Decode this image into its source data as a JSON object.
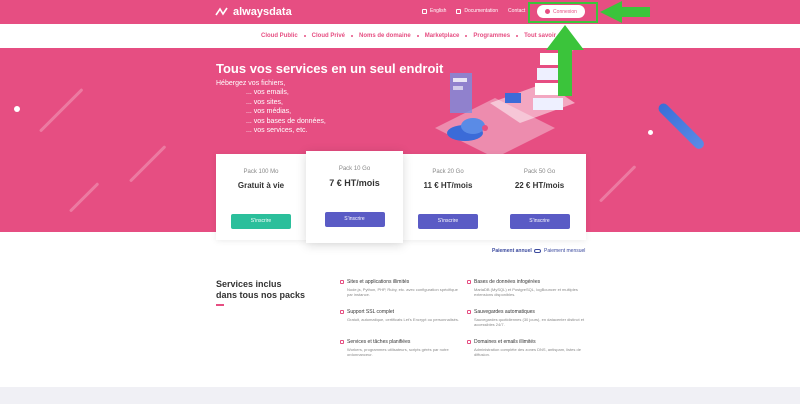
{
  "brand": {
    "name": "alwaysdata"
  },
  "topbar": {
    "links": [
      "English",
      "Documentation",
      "Contact"
    ],
    "login_label": "Connexion"
  },
  "nav": {
    "items": [
      "Cloud Public",
      "Cloud Privé",
      "Noms de domaine",
      "Marketplace",
      "Programmes",
      "Tout savoir"
    ]
  },
  "hero": {
    "title": "Tous vos services en un seul endroit",
    "subtitle": "Hébergez vos fichiers,",
    "list": [
      "... vos emails,",
      "... vos sites,",
      "... vos médias,",
      "... vos bases de données,",
      "... vos services, etc."
    ]
  },
  "pricing": {
    "packs": [
      {
        "name": "Pack 100 Mo",
        "price": "Gratuit à vie",
        "button": "S'inscrire",
        "color": "#2bbf9b"
      },
      {
        "name": "Pack 10 Go",
        "price": "7 € HT/mois",
        "button": "S'inscrire",
        "color": "#5a5bc5"
      },
      {
        "name": "Pack 20 Go",
        "price": "11 € HT/mois",
        "button": "S'inscrire",
        "color": "#5a5bc5"
      },
      {
        "name": "Pack 50 Go",
        "price": "22 € HT/mois",
        "button": "S'inscrire",
        "color": "#5a5bc5"
      }
    ],
    "billing_annual": "Paiement annuel",
    "billing_monthly": "Paiement mensuel"
  },
  "services": {
    "title_line1": "Services inclus",
    "title_line2": "dans tous nos packs",
    "features": [
      {
        "title": "Sites et applications illimités",
        "desc": "Node.js, Python, PHP, Ruby, etc. avec configuration spécifique par instance."
      },
      {
        "title": "Bases de données infogérées",
        "desc": "MariaDB (MySQL) et PostgreSQL, logBouncer et multiples extensions disponibles."
      },
      {
        "title": "Support SSL complet",
        "desc": "Gratuit, automatique, certificats Let's Encrypt ou personnalisés."
      },
      {
        "title": "Sauvegardes automatiques",
        "desc": "Sauvegardes quotidiennes (30 jours), en datacenter distinct et accessibles 24/7."
      },
      {
        "title": "Services et tâches planifiées",
        "desc": "Workers, programmes utilisateurs, scripts gérés par notre ordonnanceur."
      },
      {
        "title": "Domaines et emails illimités",
        "desc": "Administration complète des zones DNS, antispam, listes de diffusion."
      }
    ]
  },
  "colors": {
    "accent": "#e64e82",
    "primary_button": "#5a5bc5",
    "free_button": "#2bbf9b",
    "annotation": "#3bc43b"
  }
}
